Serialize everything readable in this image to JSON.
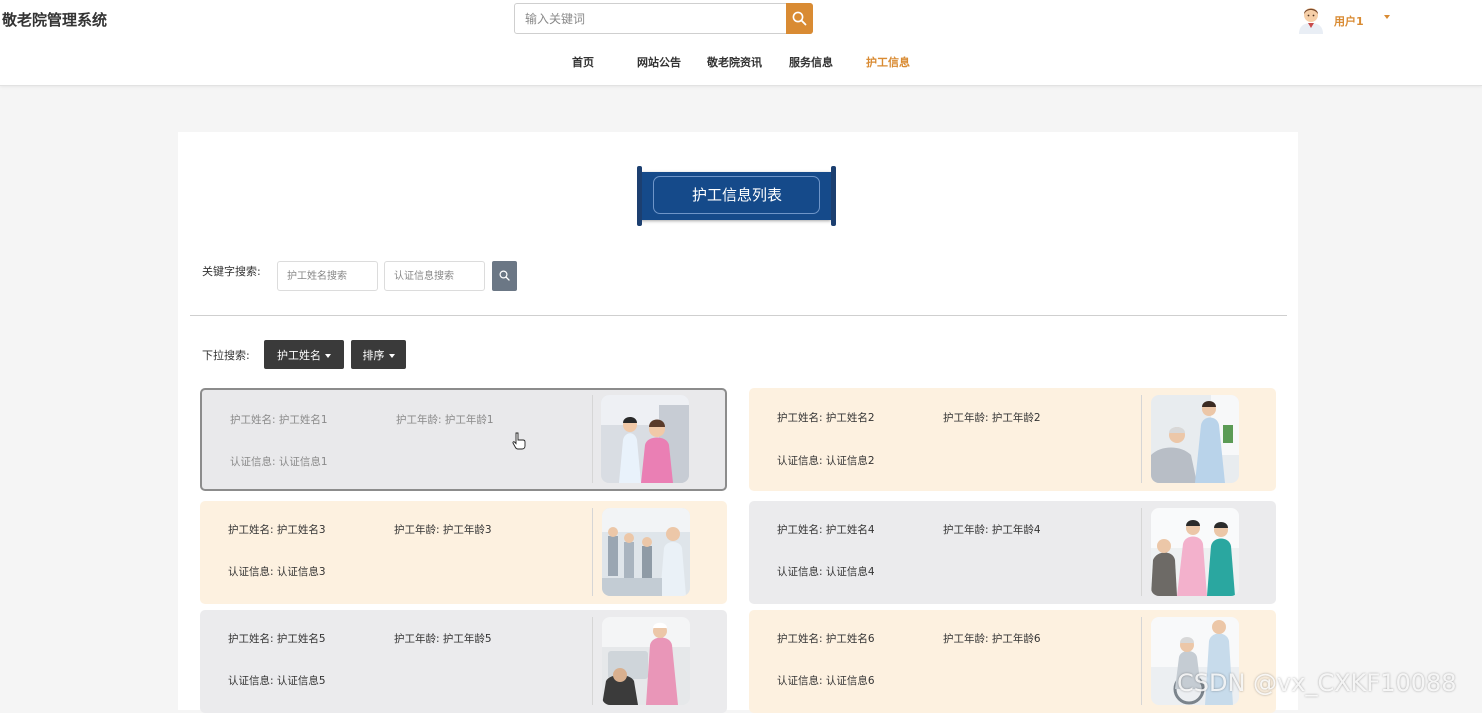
{
  "app": {
    "title": "敬老院管理系统"
  },
  "search": {
    "placeholder": "输入关键词"
  },
  "user": {
    "name": "用户1"
  },
  "nav": {
    "items": [
      {
        "label": "首页"
      },
      {
        "label": "网站公告"
      },
      {
        "label": "敬老院资讯"
      },
      {
        "label": "服务信息"
      },
      {
        "label": "护工信息",
        "active": true
      }
    ]
  },
  "page": {
    "title": "护工信息列表"
  },
  "filters": {
    "keyword_label": "关键字搜索:",
    "name_placeholder": "护工姓名搜索",
    "cert_placeholder": "认证信息搜索",
    "dropdown_label": "下拉搜索:",
    "dropdown_name": "护工姓名",
    "dropdown_sort": "排序"
  },
  "cards": [
    {
      "name": "护工姓名: 护工姓名1",
      "age": "护工年龄: 护工年龄1",
      "cert": "认证信息: 认证信息1"
    },
    {
      "name": "护工姓名: 护工姓名2",
      "age": "护工年龄: 护工年龄2",
      "cert": "认证信息: 认证信息2"
    },
    {
      "name": "护工姓名: 护工姓名3",
      "age": "护工年龄: 护工年龄3",
      "cert": "认证信息: 认证信息3"
    },
    {
      "name": "护工姓名: 护工姓名4",
      "age": "护工年龄: 护工年龄4",
      "cert": "认证信息: 认证信息4"
    },
    {
      "name": "护工姓名: 护工姓名5",
      "age": "护工年龄: 护工年龄5",
      "cert": "认证信息: 认证信息5"
    },
    {
      "name": "护工姓名: 护工姓名6",
      "age": "护工年龄: 护工年龄6",
      "cert": "认证信息: 认证信息6"
    }
  ],
  "watermark": "CSDN @vx_CXKF10088",
  "colors": {
    "accent": "#d98b33",
    "banner": "#154a8a",
    "card_grey": "#ebebed",
    "card_cream": "#fdf1e0"
  }
}
